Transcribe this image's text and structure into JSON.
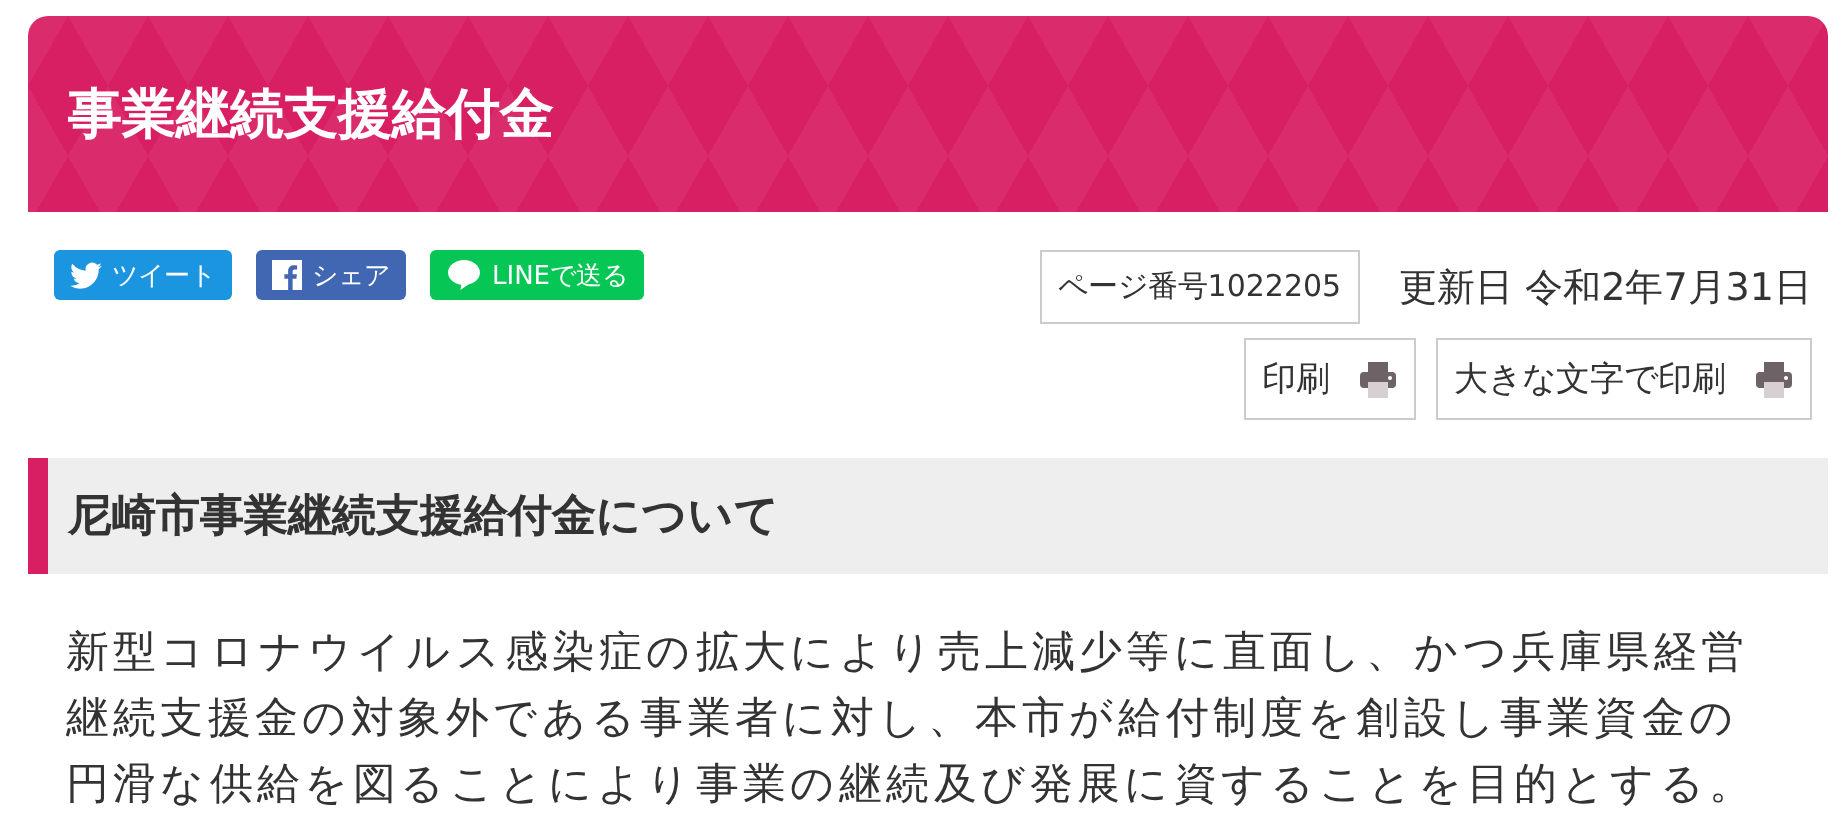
{
  "header": {
    "title": "事業継続支援給付金"
  },
  "share_buttons": [
    {
      "kind": "twitter",
      "label": "ツイート"
    },
    {
      "kind": "facebook",
      "label": "シェア"
    },
    {
      "kind": "line",
      "label": "LINEで送る"
    }
  ],
  "page_number": "ページ番号1022205",
  "updated": "更新日 令和2年7月31日",
  "print_buttons": [
    "印刷",
    "大きな文字で印刷"
  ],
  "section": {
    "heading": "尼崎市事業継続支援給付金について",
    "paragraph": "新型コロナウイルス感染症の拡大により売上減少等に直面し、かつ兵庫県経営継続支援金の対象外である事業者に対し、本市が給付制度を創設し事業資金の円滑な供給を図ることにより事業の継続及び発展に資することを目的とする。"
  }
}
